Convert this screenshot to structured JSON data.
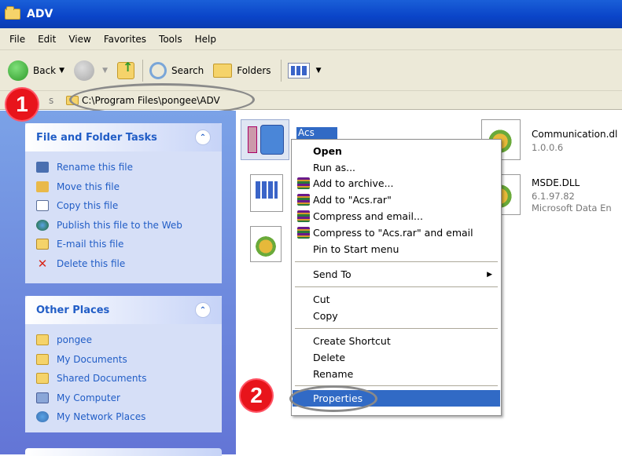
{
  "window": {
    "title": "ADV"
  },
  "menu": [
    "File",
    "Edit",
    "View",
    "Favorites",
    "Tools",
    "Help"
  ],
  "toolbar": {
    "back": "Back",
    "search": "Search",
    "folders": "Folders"
  },
  "address": {
    "label": "s",
    "value": "C:\\Program Files\\pongee\\ADV"
  },
  "tasks_panel": {
    "title": "File and Folder Tasks",
    "items": [
      "Rename this file",
      "Move this file",
      "Copy this file",
      "Publish this file to the Web",
      "E-mail this file",
      "Delete this file"
    ]
  },
  "places_panel": {
    "title": "Other Places",
    "items": [
      "pongee",
      "My Documents",
      "Shared Documents",
      "My Computer",
      "My Network Places"
    ]
  },
  "files": {
    "acs": "Acs",
    "communication_name": "Communication.dl",
    "communication_ver": "1.0.0.6",
    "msde_name": "MSDE.DLL",
    "msde_ver": "6.1.97.82",
    "msde_desc": "Microsoft Data En"
  },
  "context_menu": {
    "open": "Open",
    "run_as": "Run as...",
    "add_archive": "Add to archive...",
    "add_acs_rar": "Add to \"Acs.rar\"",
    "compress_email": "Compress and email...",
    "compress_acs_email": "Compress to \"Acs.rar\" and email",
    "pin_start": "Pin to Start menu",
    "send_to": "Send To",
    "cut": "Cut",
    "copy": "Copy",
    "create_shortcut": "Create Shortcut",
    "delete": "Delete",
    "rename": "Rename",
    "properties": "Properties"
  },
  "badges": {
    "one": "1",
    "two": "2"
  },
  "colors": {
    "title_bar": "#0a44c8",
    "task_link": "#215dc6",
    "selection": "#316ac5",
    "badge": "#e8141b"
  }
}
